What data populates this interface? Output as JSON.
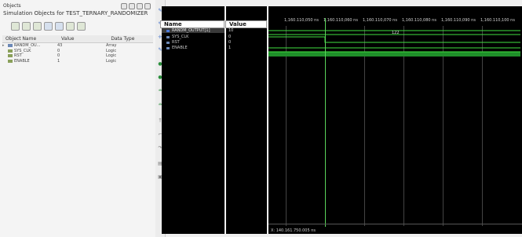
{
  "objects": {
    "header": "Objects",
    "subtitle": "Simulation Objects for TEST_TERNARY_RANDOMIZER",
    "columns": [
      "Object Name",
      "Value",
      "Data Type"
    ],
    "rows": [
      {
        "name": "RANDM_OU...",
        "value": "43",
        "type": "Array",
        "icon": "bus-icon",
        "expandable": true
      },
      {
        "name": "SYS_CLK",
        "value": "0",
        "type": "Logic",
        "icon": "signal-icon",
        "expandable": false
      },
      {
        "name": "RST",
        "value": "0",
        "type": "Logic",
        "icon": "signal-icon",
        "expandable": false
      },
      {
        "name": "ENABLE",
        "value": "1",
        "type": "Logic",
        "icon": "signal-icon",
        "expandable": false
      }
    ]
  },
  "wave": {
    "name_header": "Name",
    "value_header": "Value",
    "rows": [
      {
        "name": "RANDM_OUTPUT[1]",
        "value": "10",
        "selected": true
      },
      {
        "name": "SYS_CLK",
        "value": "0",
        "selected": false
      },
      {
        "name": "RST",
        "value": "0",
        "selected": false
      },
      {
        "name": "ENABLE",
        "value": "1",
        "selected": false
      }
    ],
    "time_labels": [
      "1,160.110,050 ns",
      "1,160.110,060 ns",
      "1,160.110,070 ns",
      "1,160.110,080 ns",
      "1,160.110,090 ns",
      "1,160.110,100 ns"
    ],
    "bus_value": "122",
    "cursor_readout": "X: 140.161.750.005 ns"
  },
  "colors": {
    "wave_green": "#3fe03f",
    "enable_fill": "#1f8f2a",
    "background": "#000000"
  }
}
